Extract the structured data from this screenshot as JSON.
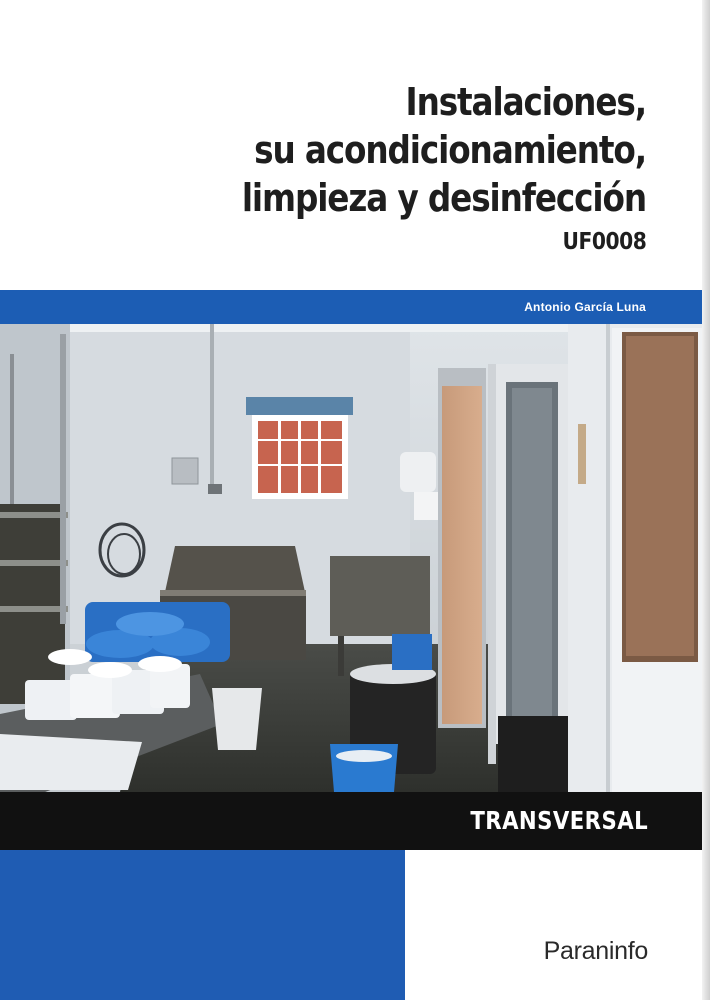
{
  "book": {
    "title_lines": [
      "Instalaciones,",
      "su acondicionamiento,",
      "limpieza y desinfección"
    ],
    "code": "UF0008",
    "author": "Antonio García Luna",
    "collection": "TRANSVERSAL",
    "publisher": "Paraninfo"
  },
  "colors": {
    "brand_blue": "#1c5db4",
    "dark_band": "#111111",
    "background": "#ffffff"
  }
}
